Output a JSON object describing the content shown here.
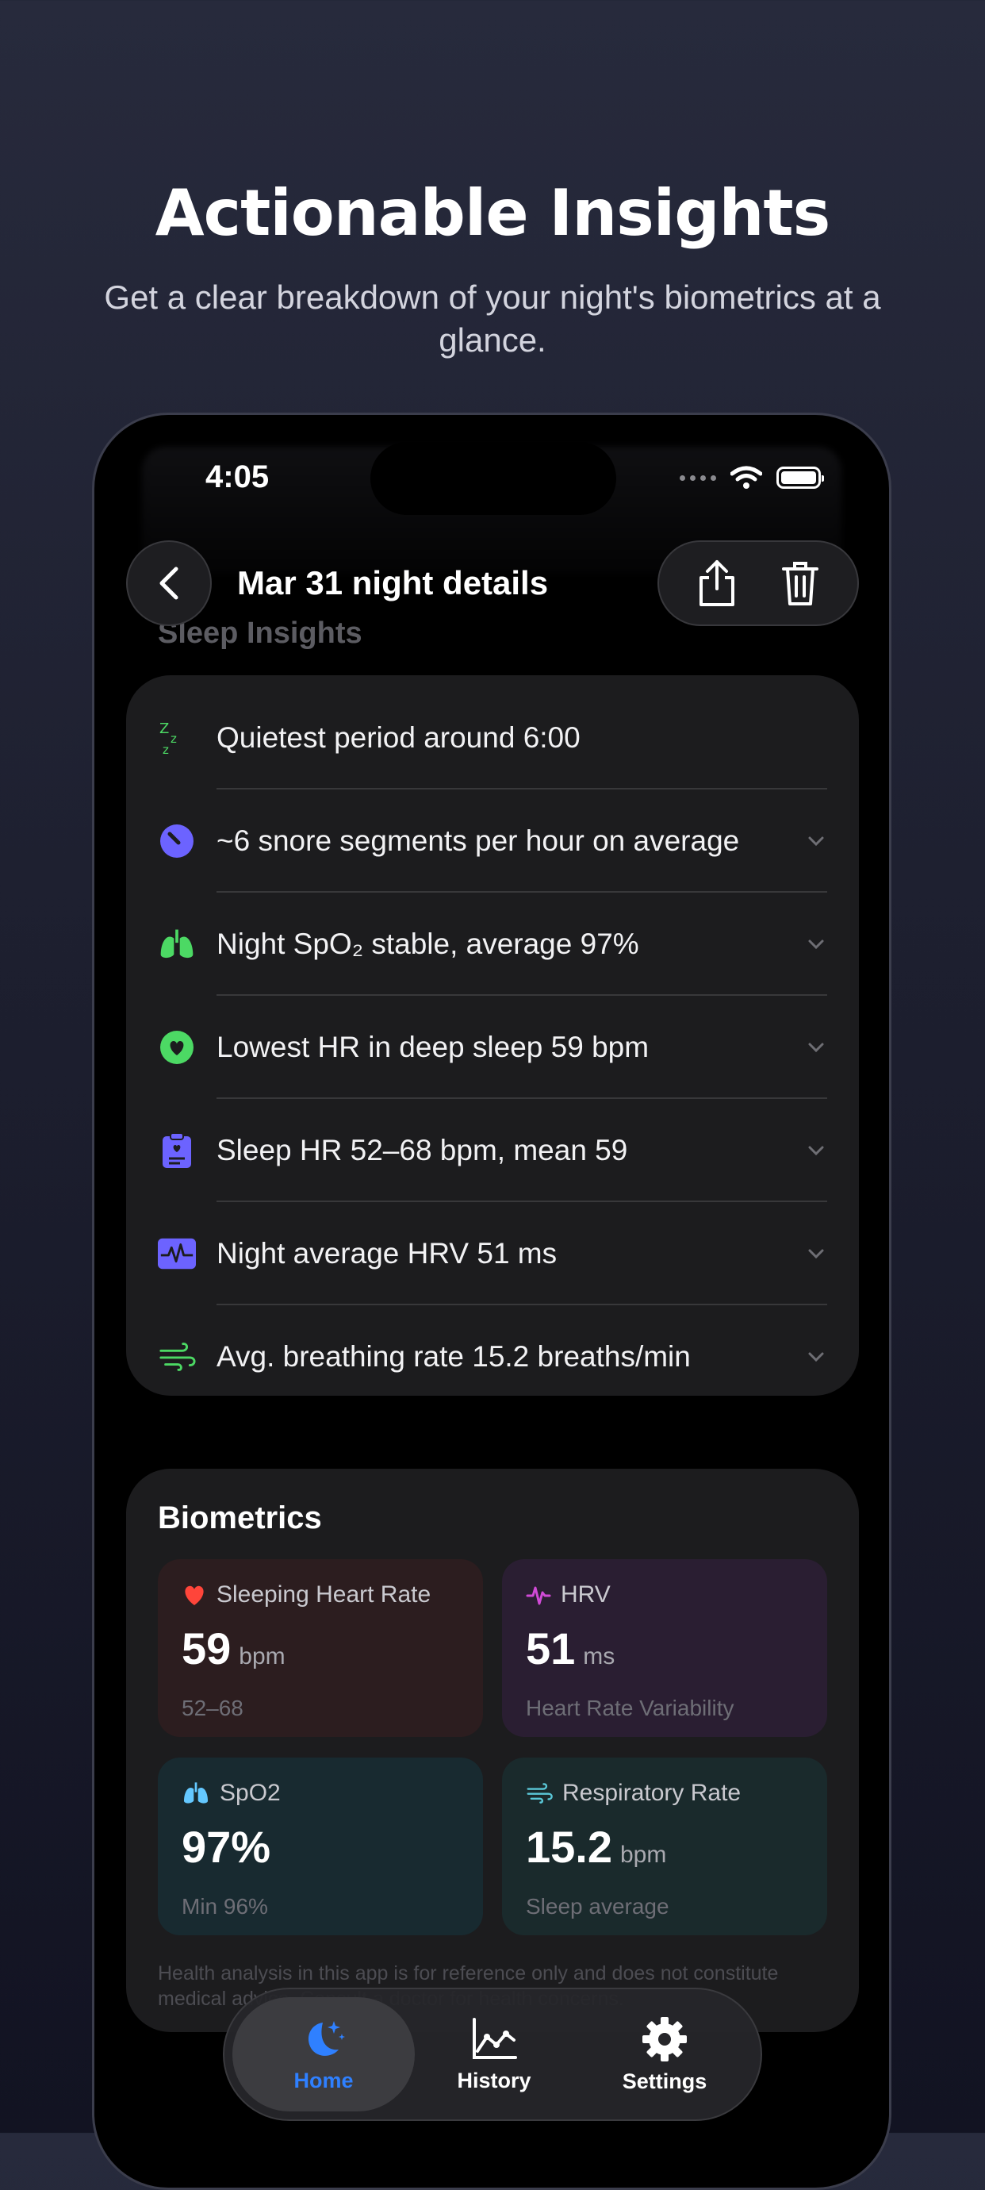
{
  "hero": {
    "title": "Actionable Insights",
    "subtitle": "Get a clear breakdown of your night's biometrics at a glance."
  },
  "status_bar": {
    "time": "4:05"
  },
  "nav": {
    "title": "Mar 31 night details",
    "ghost_section": "Sleep Insights"
  },
  "insights": [
    {
      "icon": "zzz-icon",
      "label": "Quietest period around 6:00",
      "expandable": false
    },
    {
      "icon": "snore-gauge-icon",
      "label": "~6 snore segments per hour on average",
      "expandable": true
    },
    {
      "icon": "lungs-icon",
      "label": "Night SpO₂ stable, average 97%",
      "expandable": true
    },
    {
      "icon": "heart-circle-icon",
      "label": "Lowest HR in deep sleep 59 bpm",
      "expandable": true
    },
    {
      "icon": "clipboard-heart-icon",
      "label": "Sleep HR 52–68 bpm, mean 59",
      "expandable": true
    },
    {
      "icon": "waveform-icon",
      "label": "Night average HRV 51 ms",
      "expandable": true
    },
    {
      "icon": "wind-icon",
      "label": "Avg. breathing rate 15.2 breaths/min",
      "expandable": true
    }
  ],
  "biometrics": {
    "title": "Biometrics",
    "tiles": [
      {
        "icon": "heart-icon",
        "name": "Sleeping Heart Rate",
        "value": "59",
        "unit": "bpm",
        "sub": "52–68",
        "color": "#ff453a"
      },
      {
        "icon": "pulse-icon",
        "name": "HRV",
        "value": "51",
        "unit": "ms",
        "sub": "Heart Rate Variability",
        "color": "#d04ad6"
      },
      {
        "icon": "lungs-icon",
        "name": "SpO2",
        "value": "97%",
        "unit": "",
        "sub": "Min 96%",
        "color": "#64c8ff"
      },
      {
        "icon": "wind-icon",
        "name": "Respiratory Rate",
        "value": "15.2",
        "unit": "bpm",
        "sub": "Sleep average",
        "color": "#5ac8d8"
      }
    ],
    "disclaimer": "Health analysis in this app is for reference only and does not constitute medical advice. Consult a doctor for health concerns."
  },
  "tabs": [
    {
      "label": "Home",
      "icon": "moon-stars-icon",
      "active": true
    },
    {
      "label": "History",
      "icon": "chart-line-icon",
      "active": false
    },
    {
      "label": "Settings",
      "icon": "gear-icon",
      "active": false
    }
  ],
  "colors": {
    "accent_blue": "#2f80ff",
    "accent_green": "#4cd964",
    "accent_purple": "#6c63ff"
  }
}
